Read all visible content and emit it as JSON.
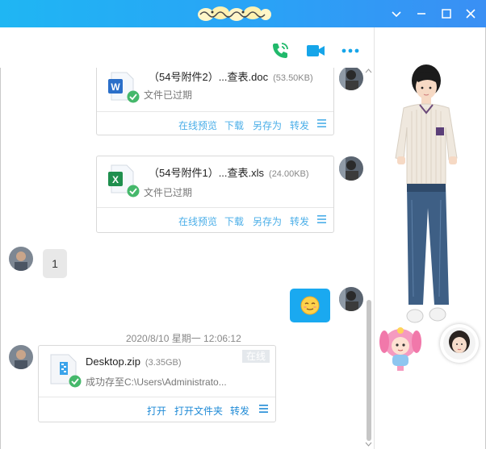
{
  "window": {
    "title_art": "chat-contact-name-art",
    "buttons": {
      "dropdown": "chevron-down-icon",
      "minimize": "minimize-icon",
      "maximize": "maximize-icon",
      "close": "close-icon"
    }
  },
  "toolbar": {
    "voice_call": "phone-icon",
    "video_call": "video-icon",
    "more": "more-icon"
  },
  "messages": {
    "file1": {
      "name": "（54号附件2）...查表.doc",
      "size": "(53.50KB)",
      "status": "文件已过期",
      "actions": [
        "在线预览",
        "下载",
        "另存为",
        "转发"
      ]
    },
    "file2": {
      "name": "（54号附件1）...查表.xls",
      "size": "(24.00KB)",
      "status": "文件已过期",
      "actions": [
        "在线预览",
        "下载",
        "另存为",
        "转发"
      ]
    },
    "text_in": "1",
    "emoji_out": "smiley-icon",
    "timestamp": "2020/8/10 星期一 12:06:12",
    "file3": {
      "name": "Desktop.zip",
      "size": "(3.35GB)",
      "badge": "在线",
      "status": "成功存至C:\\Users\\Administrato...",
      "actions": [
        "打开",
        "打开文件夹",
        "转发"
      ]
    }
  },
  "colors": {
    "titlebar": "#2aa2f6",
    "bubble_out": "#1aa9f0",
    "link": "#4aaee8"
  }
}
